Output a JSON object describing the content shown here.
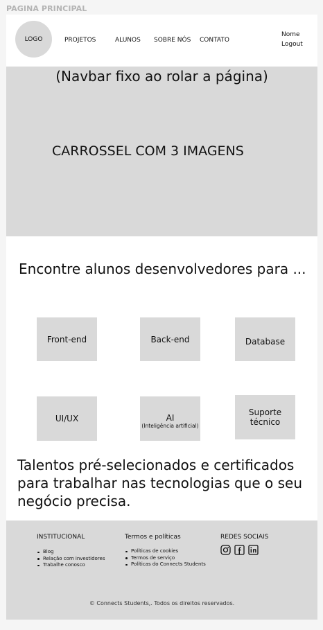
{
  "frame_label": "PAGINA PRINCIPAL",
  "header": {
    "logo": "LOGO",
    "nav": [
      "PROJETOS",
      "ALUNOS",
      "SOBRE NÓS",
      "CONTATO"
    ],
    "user_name": "Nome",
    "logout": "Logout"
  },
  "hero": {
    "note": "(Navbar fixo ao rolar a página)",
    "carousel": "CARROSSEL COM 3 IMAGENS"
  },
  "intro": "Encontre alunos desenvolvedores para ...",
  "categories": [
    {
      "label": "Front-end",
      "sub": ""
    },
    {
      "label": "Back-end",
      "sub": ""
    },
    {
      "label": "Database",
      "sub": ""
    },
    {
      "label": "UI/UX",
      "sub": ""
    },
    {
      "label": "AI",
      "sub": "(Inteligência artificial)"
    },
    {
      "label": "Suporte técnico",
      "sub": ""
    }
  ],
  "talents": "Talentos pré-selecionados e certificados para trabalhar nas tecnologias que o seu negócio precisa.",
  "footer": {
    "institucional": {
      "title": "INSTITUCIONAL",
      "items": [
        "Blog",
        "Relação com investidores",
        "Trabalhe conosco"
      ]
    },
    "politicas": {
      "title": "Termos e políticas",
      "items": [
        "Políticas de cookies",
        "Termos de serviço",
        "Políticas do Connects Students"
      ]
    },
    "redes": {
      "title": "REDES SOCIAIS",
      "icons": [
        "instagram-icon",
        "facebook-icon",
        "linkedin-icon"
      ]
    },
    "copyright": "© Connects Students,. Todos os direitos reservados."
  }
}
